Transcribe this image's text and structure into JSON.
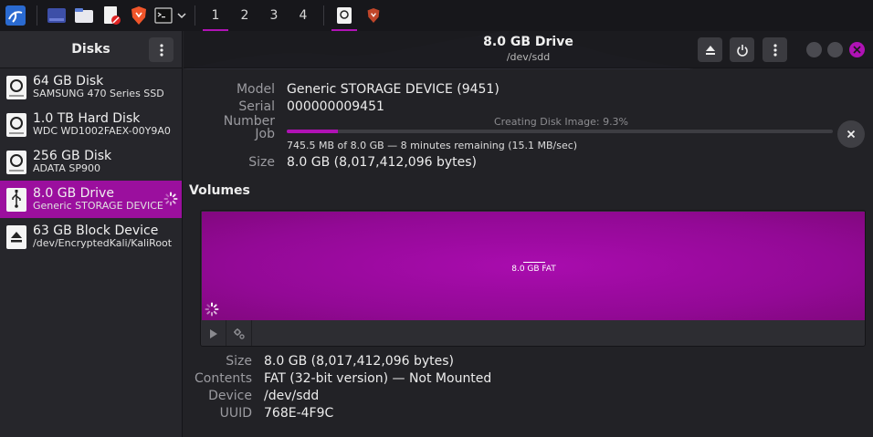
{
  "taskbar": {
    "apps": [
      {
        "name": "kali-menu-icon"
      },
      {
        "name": "show-desktop-icon"
      },
      {
        "name": "file-manager-icon"
      },
      {
        "name": "text-editor-icon"
      },
      {
        "name": "brave-browser-icon"
      },
      {
        "name": "terminal-icon"
      }
    ],
    "workspaces": [
      "1",
      "2",
      "3",
      "4"
    ],
    "active_workspace": 0,
    "colors": {
      "accent": "#b012b5"
    }
  },
  "sidebar": {
    "title": "Disks",
    "devices": [
      {
        "name": "64 GB Disk",
        "sub": "SAMSUNG 470 Series SSD",
        "icon": "disk-icon"
      },
      {
        "name": "1.0 TB Hard Disk",
        "sub": "WDC WD1002FAEX-00Y9A0",
        "icon": "disk-icon"
      },
      {
        "name": "256 GB Disk",
        "sub": "ADATA SP900",
        "icon": "disk-icon"
      },
      {
        "name": "8.0 GB Drive",
        "sub": "Generic STORAGE DEVICE",
        "icon": "usb-drive-icon",
        "selected": true
      },
      {
        "name": "63 GB Block Device",
        "sub": "/dev/EncryptedKali/KaliRoot",
        "icon": "block-device-icon"
      }
    ]
  },
  "header": {
    "title": "8.0 GB Drive",
    "subtitle": "/dev/sdd"
  },
  "drive": {
    "model_label": "Model",
    "model": "Generic STORAGE DEVICE (9451)",
    "serial_label": "Serial Number",
    "serial": "000000009451",
    "job_label": "Job",
    "job_title": "Creating Disk Image: 9.3%",
    "job_progress": 0.093,
    "job_detail": "745.5 MB of 8.0 GB — 8 minutes remaining (15.1 MB/sec)",
    "size_label": "Size",
    "size": "8.0 GB (8,017,412,096 bytes)"
  },
  "volumes": {
    "title": "Volumes",
    "partition_label": "8.0 GB FAT",
    "size_label": "Size",
    "size": "8.0 GB (8,017,412,096 bytes)",
    "contents_label": "Contents",
    "contents": "FAT (32-bit version) — Not Mounted",
    "device_label": "Device",
    "device": "/dev/sdd",
    "uuid_label": "UUID",
    "uuid": "768E-4F9C"
  }
}
